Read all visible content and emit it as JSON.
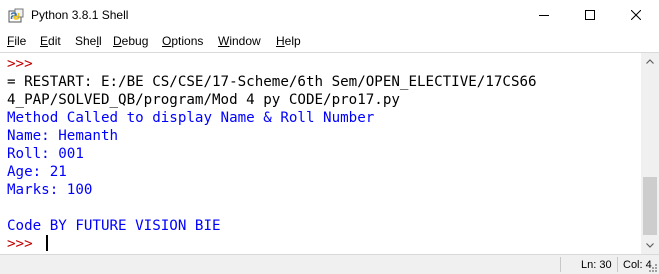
{
  "window": {
    "title": "Python 3.8.1 Shell",
    "icon": "python-icon",
    "buttons": [
      "minimize-icon",
      "maximize-icon",
      "close-icon"
    ]
  },
  "menu": {
    "items": [
      {
        "label": "File",
        "mnemonic": "F",
        "rest": "ile"
      },
      {
        "label": "Edit",
        "mnemonic": "E",
        "rest": "dit"
      },
      {
        "label": "Shell",
        "prefix": "She",
        "mnemonic": "l",
        "rest": "l"
      },
      {
        "label": "Debug",
        "mnemonic": "D",
        "rest": "ebug"
      },
      {
        "label": "Options",
        "mnemonic": "O",
        "rest": "ptions"
      },
      {
        "label": "Window",
        "mnemonic": "W",
        "rest": "indow"
      },
      {
        "label": "Help",
        "mnemonic": "H",
        "rest": "elp"
      }
    ]
  },
  "shell": {
    "lines": [
      {
        "kind": "prompt",
        "text": ">>>"
      },
      {
        "kind": "plain",
        "text": "= RESTART: E:/BE CS/CSE/17-Scheme/6th Sem/OPEN_ELECTIVE/17CS66"
      },
      {
        "kind": "plain",
        "text": "4_PAP/SOLVED_QB/program/Mod 4 py CODE/pro17.py"
      },
      {
        "kind": "stdout",
        "text": "Method Called to display Name & Roll Number"
      },
      {
        "kind": "stdout",
        "text": "Name: Hemanth"
      },
      {
        "kind": "stdout",
        "text": "Roll: 001"
      },
      {
        "kind": "stdout",
        "text": "Age: 21"
      },
      {
        "kind": "stdout",
        "text": "Marks: 100"
      },
      {
        "kind": "stdout",
        "text": ""
      },
      {
        "kind": "stdout",
        "text": "Code BY FUTURE VISION BIE"
      },
      {
        "kind": "prompt",
        "text": ">>> "
      }
    ]
  },
  "status": {
    "line": "Ln: 30",
    "col": "Col: 4"
  },
  "colors": {
    "prompt": "#c00000",
    "stdout": "#0000ff",
    "plain": "#000000"
  }
}
